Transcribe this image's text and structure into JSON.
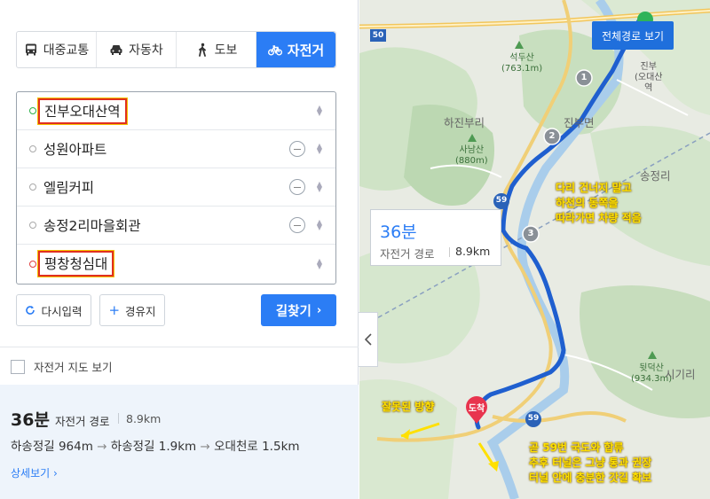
{
  "tabs": {
    "transit": "대중교통",
    "car": "자동차",
    "walk": "도보",
    "bike": "자전거"
  },
  "waypoints": [
    {
      "label": "진부오대산역",
      "type": "start",
      "highlighted": true,
      "removable": false
    },
    {
      "label": "성원아파트",
      "type": "via",
      "highlighted": false,
      "removable": true
    },
    {
      "label": "엘림커피",
      "type": "via",
      "highlighted": false,
      "removable": true
    },
    {
      "label": "송정2리마을회관",
      "type": "via",
      "highlighted": false,
      "removable": true
    },
    {
      "label": "평창청심대",
      "type": "end",
      "highlighted": true,
      "removable": false
    }
  ],
  "buttons": {
    "reset": "다시입력",
    "add_via": "경유지",
    "search": "길찾기"
  },
  "bike_map_toggle": "자전거 지도 보기",
  "summary": {
    "time": "36분",
    "mode": "자전거 경로",
    "distance": "8.9km",
    "path_1": "하송정길 964m",
    "path_2": "하송정길 1.9km",
    "path_3": "오대천로 1.5km",
    "detail_link": "상세보기"
  },
  "map": {
    "full_route_button": "전체경로 보기",
    "info_time": "36분",
    "info_mode": "자전거 경로",
    "info_distance": "8.9km",
    "destination_pin": "도착",
    "waypoint_numbers": [
      "1",
      "2",
      "3"
    ],
    "road_50": "50",
    "road_59": "59",
    "places": {
      "seokdusan": "석두산",
      "seokdusan_alt": "(763.1m)",
      "sanamsan": "사남산",
      "sanamsan_alt": "(880m)",
      "hajinburi": "하진부리",
      "jinbumyeon": "진부면",
      "songjeongri": "송정리",
      "jinbu_station_1": "진부",
      "jinbu_station_2": "(오대산",
      "jinbu_station_3": "역",
      "twitdeoksan": "뒷덕산",
      "twitdeoksan_alt": "(934.3m)",
      "sigiri": "시기리"
    }
  },
  "annotations": {
    "bridge_1": "다리 건너지 말고",
    "bridge_2": "하천의 동쪽을",
    "bridge_3": "따라가면 차량 적음",
    "wrong_way": "잘못된 방향",
    "note_1": "곧 59번 국도와 합류",
    "note_2": "추후 터널은 그냥 통과 권장",
    "note_3": "터널 안에 충분한 갓길 확보"
  },
  "colors": {
    "accent": "#2b7df5",
    "route": "#1f5fcf",
    "destination": "#e8344e",
    "annotation": "#ffe000"
  }
}
